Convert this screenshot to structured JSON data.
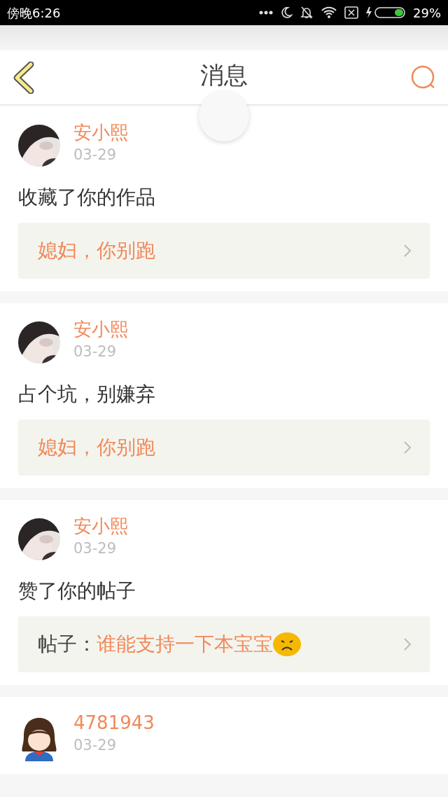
{
  "status_bar": {
    "time": "傍晚6:26",
    "battery": "29%"
  },
  "header": {
    "title": "消息"
  },
  "messages": [
    {
      "name": "安小熙",
      "date": "03-29",
      "action": "收藏了你的作品",
      "link": {
        "text": "媳妇，你别跑"
      }
    },
    {
      "name": "安小熙",
      "date": "03-29",
      "action": "占个坑，别嫌弃",
      "link": {
        "text": "媳妇，你别跑"
      }
    },
    {
      "name": "安小熙",
      "date": "03-29",
      "action": "赞了你的帖子",
      "link": {
        "prefix": "帖子：",
        "text": "谁能支持一下本宝宝",
        "emoji": true
      }
    },
    {
      "avatar": {
        "kind": "cartoon"
      },
      "name": "4781943",
      "date": "03-29"
    }
  ]
}
